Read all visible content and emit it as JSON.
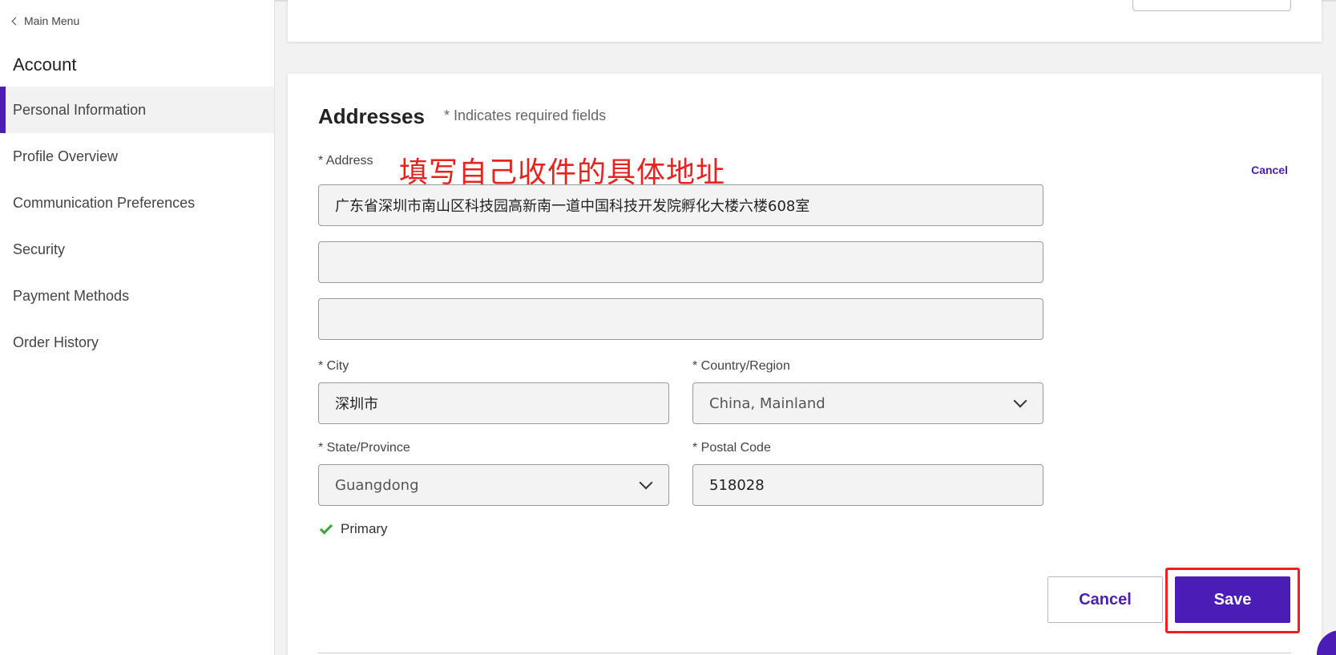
{
  "sidebar": {
    "back_label": "Main Menu",
    "title": "Account",
    "items": [
      {
        "label": "Personal Information",
        "active": true
      },
      {
        "label": "Profile Overview"
      },
      {
        "label": "Communication Preferences"
      },
      {
        "label": "Security"
      },
      {
        "label": "Payment Methods"
      },
      {
        "label": "Order History"
      }
    ]
  },
  "addresses": {
    "heading": "Addresses",
    "required_note": "* Indicates required fields",
    "cancel_link": "Cancel",
    "annotation": "填写自己收件的具体地址",
    "address_label": "* Address",
    "address_line1": "广东省深圳市南山区科技园高新南一道中国科技开发院孵化大楼六楼608室",
    "address_line2": "",
    "address_line3": "",
    "city_label": "* City",
    "city_value": "深圳市",
    "country_label": "* Country/Region",
    "country_value": "China, Mainland",
    "state_label": "* State/Province",
    "state_value": "Guangdong",
    "postal_label": "* Postal Code",
    "postal_value": "518028",
    "primary_label": "Primary",
    "cancel_button": "Cancel",
    "save_button": "Save"
  },
  "colors": {
    "accent": "#4b1db6",
    "annotation": "#e8221e",
    "check": "#3aa636"
  }
}
